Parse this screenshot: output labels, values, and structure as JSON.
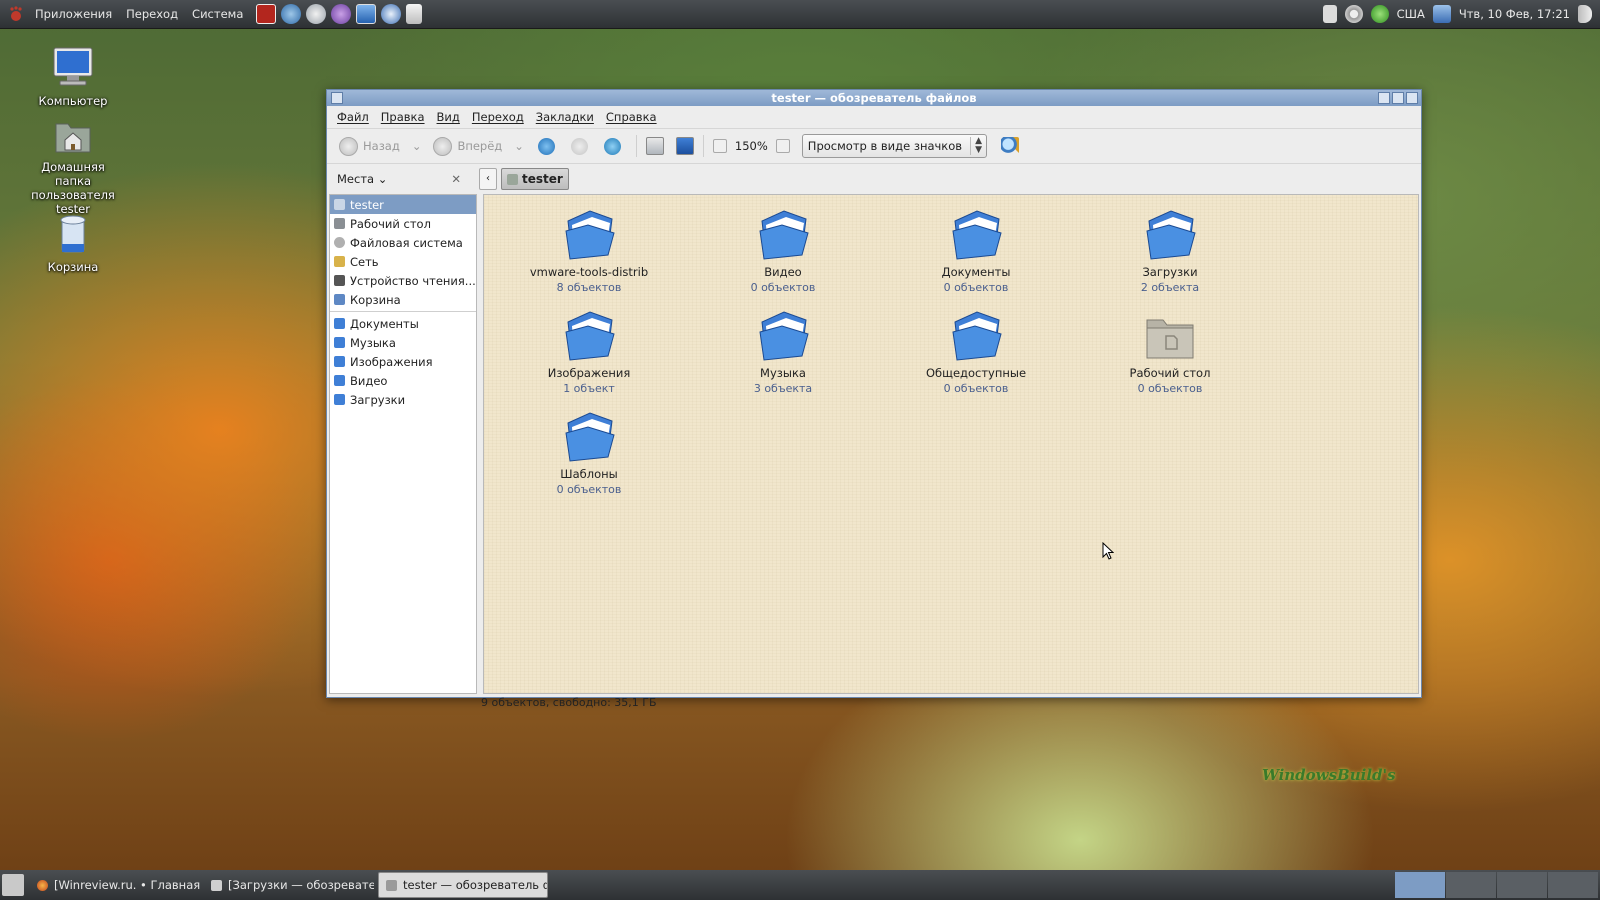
{
  "top_panel": {
    "menus": [
      "Приложения",
      "Переход",
      "Система"
    ],
    "tray": {
      "keyboard_layout": "США",
      "datetime": "Чтв, 10 Фев, 17:21"
    }
  },
  "desktop": {
    "icons": [
      {
        "label": "Компьютер"
      },
      {
        "label": "Домашняя папка пользователя tester"
      },
      {
        "label": "Корзина"
      }
    ],
    "watermark": "WindowsBuild's"
  },
  "window": {
    "title": "tester — обозреватель файлов",
    "menu": [
      "Файл",
      "Правка",
      "Вид",
      "Переход",
      "Закладки",
      "Справка"
    ],
    "toolbar": {
      "back_label": "Назад",
      "forward_label": "Вперёд",
      "zoom_level": "150%",
      "view_mode": "Просмотр в виде значков"
    },
    "sidebar": {
      "header": "Места",
      "places": [
        {
          "label": "tester",
          "active": true
        },
        {
          "label": "Рабочий стол"
        },
        {
          "label": "Файловая система"
        },
        {
          "label": "Сеть"
        },
        {
          "label": "Устройство чтения..."
        },
        {
          "label": "Корзина"
        }
      ],
      "bookmarks": [
        {
          "label": "Документы"
        },
        {
          "label": "Музыка"
        },
        {
          "label": "Изображения"
        },
        {
          "label": "Видео"
        },
        {
          "label": "Загрузки"
        }
      ]
    },
    "path": {
      "current": "tester"
    },
    "items": [
      {
        "name": "vmware-tools-distrib",
        "count": "8 объектов"
      },
      {
        "name": "Видео",
        "count": "0 объектов"
      },
      {
        "name": "Документы",
        "count": "0 объектов"
      },
      {
        "name": "Загрузки",
        "count": "2 объекта"
      },
      {
        "name": "Изображения",
        "count": "1 объект"
      },
      {
        "name": "Музыка",
        "count": "3 объекта"
      },
      {
        "name": "Общедоступные",
        "count": "0 объектов"
      },
      {
        "name": "Рабочий стол",
        "count": "0 объектов"
      },
      {
        "name": "Шаблоны",
        "count": "0 объектов"
      }
    ],
    "status": "9 объектов, свободно: 35,1 ГБ"
  },
  "taskbar": {
    "tasks": [
      {
        "label": "[Winreview.ru. • Главная с..."
      },
      {
        "label": "[Загрузки — обозревате..."
      },
      {
        "label": "tester — обозреватель ф...",
        "active": true
      }
    ]
  },
  "colors": {
    "selection": "#7d9cc4",
    "panel": "#2e3134",
    "folder_blue": "#3f7fd6",
    "iconview_bg": "#f1e6cc"
  }
}
